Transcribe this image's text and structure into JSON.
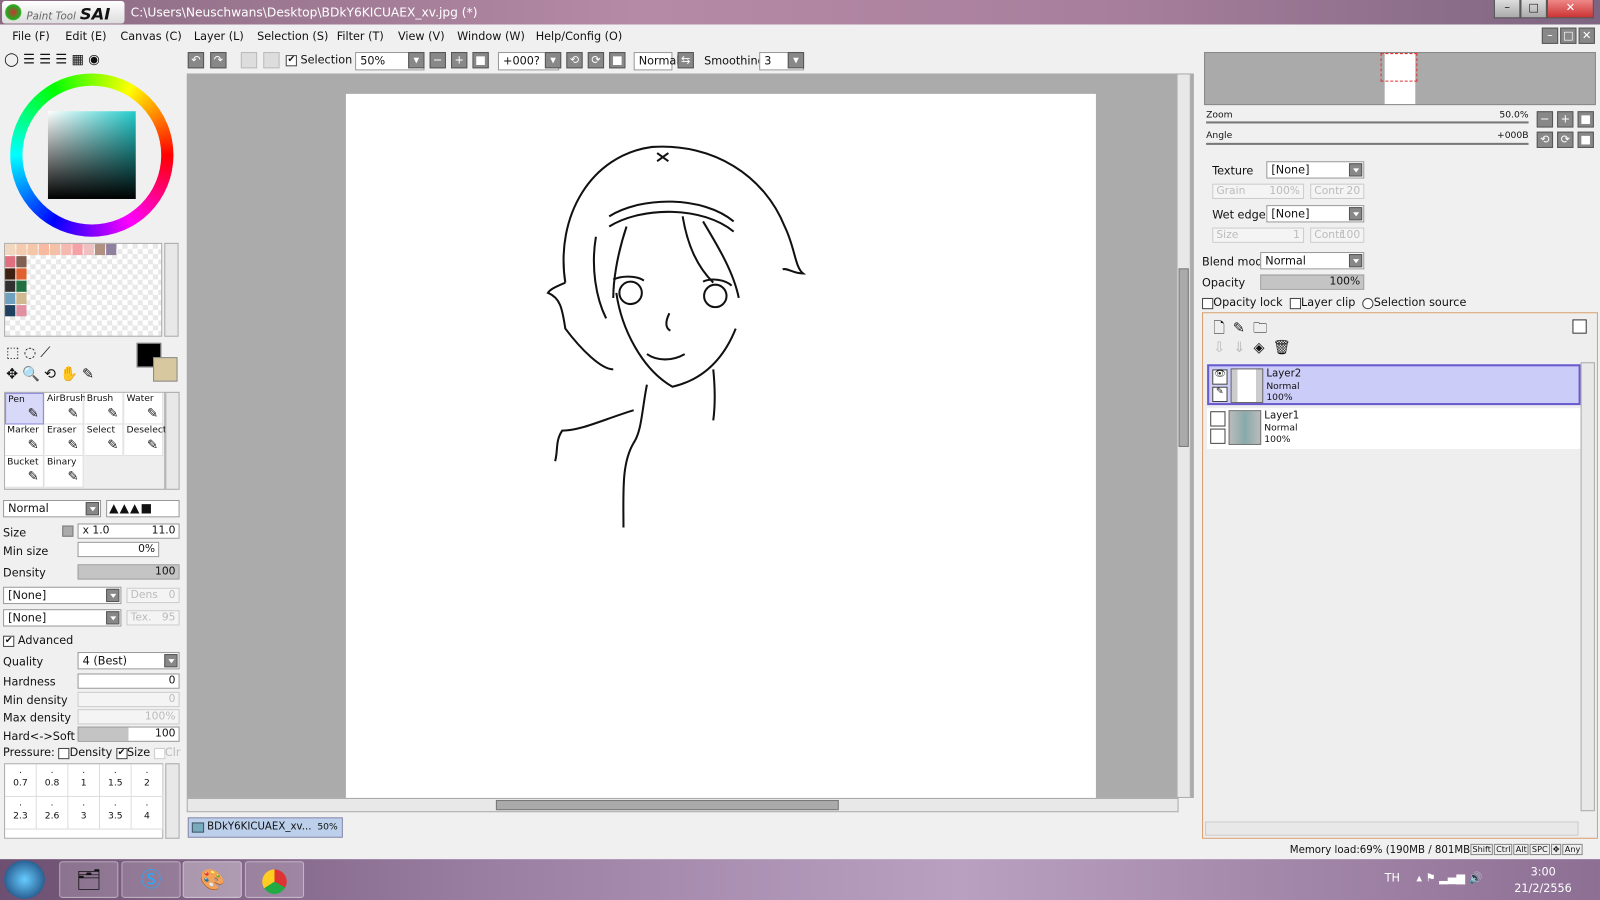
{
  "titlebar": {
    "app_logo": "PaintTool SAI",
    "title": "C:\\Users\\Neuschwans\\Desktop\\BDkY6KICUAEX_xv.jpg (*)",
    "minimize": "–",
    "maximize": "□",
    "close": "✕"
  },
  "menu": [
    "File (F)",
    "Edit (E)",
    "Canvas (C)",
    "Layer (L)",
    "Selection (S)",
    "Filter (T)",
    "View (V)",
    "Window (W)",
    "Help/Config (O)"
  ],
  "toolbar": {
    "selection_label": "Selection",
    "selection_checked": true,
    "zoom": "50%",
    "angle": "+000?",
    "blend": "Normal",
    "smoothing_label": "Smoothing",
    "smoothing": "3"
  },
  "tools": [
    {
      "label": "Pen",
      "icon": "pen-icon",
      "selected": true
    },
    {
      "label": "AirBrush",
      "icon": "airbrush-icon"
    },
    {
      "label": "Brush",
      "icon": "brush-icon"
    },
    {
      "label": "Water",
      "icon": "water-icon"
    },
    {
      "label": "Marker",
      "icon": "marker-icon"
    },
    {
      "label": "Eraser",
      "icon": "eraser-icon"
    },
    {
      "label": "Select",
      "icon": "select-icon"
    },
    {
      "label": "Deselect",
      "icon": "deselect-icon"
    },
    {
      "label": "Bucket",
      "icon": "bucket-icon"
    },
    {
      "label": "Binary",
      "icon": "binary-icon"
    }
  ],
  "brush": {
    "mode": "Normal",
    "size_label": "Size",
    "size_mult": "x 1.0",
    "size": "11.0",
    "min_size_label": "Min size",
    "min_size": "0%",
    "density_label": "Density",
    "density": "100",
    "shape": "[None]",
    "shape_dens_label": "Dens",
    "shape_dens": "0",
    "texture": "[None]",
    "texture_label": "Tex.",
    "texture_val": "95",
    "advanced_label": "Advanced",
    "advanced_checked": true,
    "quality_label": "Quality",
    "quality": "4 (Best)",
    "hardness_label": "Hardness",
    "hardness": "0",
    "min_density_label": "Min density",
    "min_density": "0",
    "max_density_label": "Max density",
    "max_density": "100%",
    "hardsoft_label": "Hard<->Soft",
    "hardsoft": "100",
    "pressure_label": "Pressure:",
    "pressure_density": "Density",
    "pressure_size": "Size",
    "pressure_clr": "Clr",
    "presets": [
      "0.7",
      "0.8",
      "1",
      "1.5",
      "2",
      "2.3",
      "2.6",
      "3",
      "3.5",
      "4"
    ]
  },
  "colors": {
    "primary": "#000000",
    "secondary": "#d8c8a0",
    "swatches": [
      "#f2d7c0",
      "#f5cbb0",
      "#f6c6a8",
      "#f7b9a0",
      "#f4c0a8",
      "#f6b9b0",
      "#f6a0a8",
      "#f0c0c0",
      "#b09080",
      "#9080a0",
      "#e07080",
      "#806050",
      "#402010",
      "#e06030",
      "#303030",
      "#207040",
      "#70a0c0",
      "#d0b890",
      "#204060",
      "#e090a0"
    ]
  },
  "navigator": {
    "zoom_label": "Zoom",
    "zoom": "50.0%",
    "angle_label": "Angle",
    "angle": "+000B"
  },
  "layer_props": {
    "texture_label": "Texture",
    "texture": "[None]",
    "grain_label": "Grain",
    "grain": "100%",
    "contr_label": "Contr",
    "contr": "20",
    "wet_label": "Wet edge",
    "wet": "[None]",
    "wsize_label": "Size",
    "wsize": "1",
    "wcontr": "100",
    "blend_label": "Blend mode",
    "blend": "Normal",
    "opacity_label": "Opacity",
    "opacity": "100%",
    "opacity_lock": "Opacity lock",
    "layer_clip": "Layer clip",
    "selection_source": "Selection source"
  },
  "layers": [
    {
      "name": "Layer2",
      "mode": "Normal",
      "opacity": "100%",
      "selected": true,
      "visible": true
    },
    {
      "name": "Layer1",
      "mode": "Normal",
      "opacity": "100%",
      "selected": false,
      "visible": false
    }
  ],
  "doc_tab": {
    "name": "BDkY6KICUAEX_xv...",
    "zoom": "50%"
  },
  "status": {
    "memory": "Memory load:69% (190MB / 801MB)",
    "keys": [
      "Shift",
      "Ctrl",
      "Alt",
      "SPC",
      "✥",
      "Any"
    ]
  },
  "taskbar": {
    "lang": "TH",
    "time": "3:00",
    "date": "21/2/2556",
    "apps": [
      "explorer-icon",
      "skype-icon",
      "sai-icon",
      "chrome-icon"
    ]
  }
}
